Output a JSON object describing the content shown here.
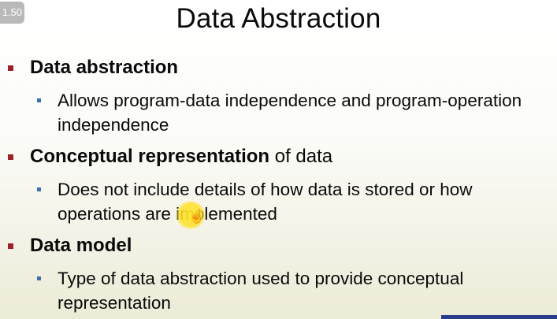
{
  "player": {
    "speed_label": "1.50"
  },
  "slide": {
    "title": "Data Abstraction",
    "bullets": [
      {
        "bold": "Data abstraction",
        "rest": "",
        "sub": "Allows program-data independence and program-operation independence"
      },
      {
        "bold": "Conceptual representation",
        "rest": " of data",
        "sub": "Does not include details of how data is stored or how operations are implemented"
      },
      {
        "bold": "Data model",
        "rest": "",
        "sub": "Type of data abstraction used to provide conceptual representation"
      }
    ]
  },
  "colors": {
    "level1_bullet": "#a0202a",
    "level2_bullet": "#3a6fb0",
    "highlighter": "#ffe628"
  },
  "icons": {
    "cursor": "hand-pointer-icon"
  }
}
